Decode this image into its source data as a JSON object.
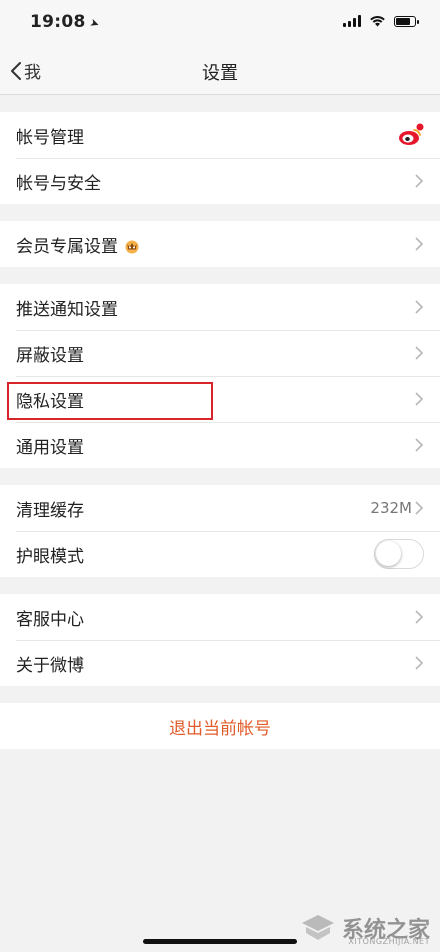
{
  "status_bar": {
    "time": "19:08",
    "location_arrow": "➤"
  },
  "nav": {
    "back_label": "我",
    "title": "设置"
  },
  "groups": [
    {
      "items": [
        {
          "label": "帐号管理",
          "right": "weibo-icon"
        },
        {
          "label": "帐号与安全",
          "right": "chevron"
        }
      ]
    },
    {
      "items": [
        {
          "label": "会员专属设置",
          "badge": "crown-icon",
          "right": "chevron"
        }
      ]
    },
    {
      "items": [
        {
          "label": "推送通知设置",
          "right": "chevron"
        },
        {
          "label": "屏蔽设置",
          "right": "chevron"
        },
        {
          "label": "隐私设置",
          "right": "chevron",
          "highlighted": true
        },
        {
          "label": "通用设置",
          "right": "chevron"
        }
      ]
    },
    {
      "items": [
        {
          "label": "清理缓存",
          "value": "232M",
          "right": "chevron"
        },
        {
          "label": "护眼模式",
          "right": "toggle",
          "toggle_on": false
        }
      ]
    },
    {
      "items": [
        {
          "label": "客服中心",
          "right": "chevron"
        },
        {
          "label": "关于微博",
          "right": "chevron"
        }
      ]
    }
  ],
  "logout_label": "退出当前帐号",
  "colors": {
    "accent": "#e25c2b",
    "highlight_border": "#d8252c",
    "background": "#f2f2f2"
  },
  "watermark": {
    "main": "系统之家",
    "sub": "XITONGZHIJIA.NET"
  }
}
